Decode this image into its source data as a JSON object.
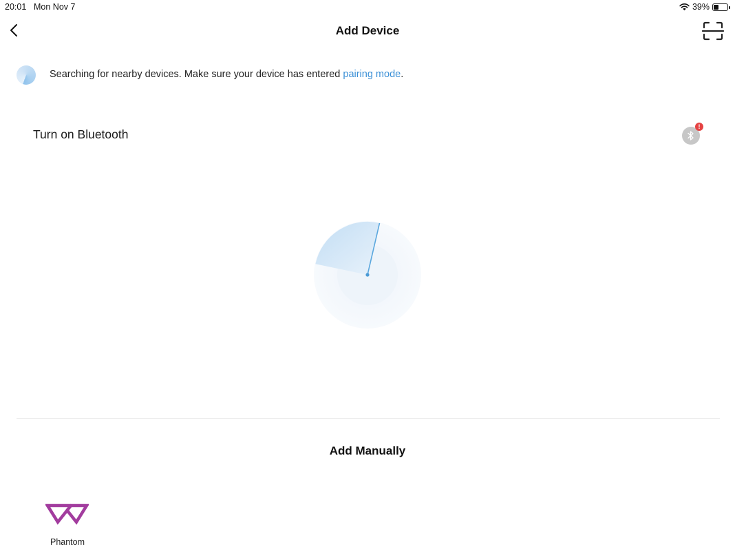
{
  "status_bar": {
    "time": "20:01",
    "date": "Mon Nov 7",
    "battery_percent_label": "39%",
    "battery_level": 0.39
  },
  "nav": {
    "title": "Add Device",
    "back_icon": "chevron-left-icon",
    "scan_icon": "scan-icon"
  },
  "search_hint": {
    "text_before": "Searching for nearby devices. Make sure your device has entered ",
    "link_text": "pairing mode",
    "text_after": ".",
    "link_color": "#3a8fd6"
  },
  "bluetooth": {
    "label": "Turn on Bluetooth",
    "icon": "bluetooth-icon",
    "badge": "!",
    "badge_color": "#e54343"
  },
  "add_manually": {
    "title": "Add Manually",
    "devices": [
      {
        "name": "Phantom",
        "icon": "phantom-logo-icon",
        "brand_color": "#a23c9e"
      }
    ]
  }
}
